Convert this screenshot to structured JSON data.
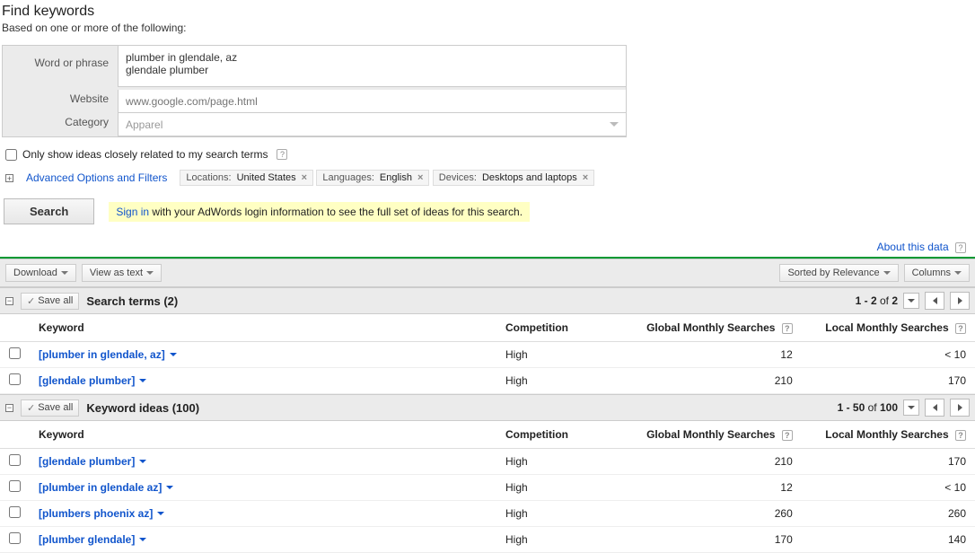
{
  "header": {
    "title": "Find keywords",
    "subtitle": "Based on one or more of the following:"
  },
  "form": {
    "labels": {
      "word": "Word or phrase",
      "website": "Website",
      "category": "Category"
    },
    "word_value": "plumber in glendale, az\nglendale plumber",
    "website_placeholder": "www.google.com/page.html",
    "category_value": "Apparel"
  },
  "only_show": {
    "label": "Only show ideas closely related to my search terms"
  },
  "advanced": {
    "link": "Advanced Options and Filters",
    "chips": [
      {
        "label": "Locations:",
        "value": "United States"
      },
      {
        "label": "Languages:",
        "value": "English"
      },
      {
        "label": "Devices:",
        "value": "Desktops and laptops"
      }
    ]
  },
  "search_btn": "Search",
  "signin_hint": {
    "link": "Sign in",
    "rest": " with your AdWords login information to see the full set of ideas for this search."
  },
  "about_link": "About this data",
  "toolbar": {
    "download": "Download",
    "view_as_text": "View as text",
    "sort": "Sorted by Relevance",
    "columns": "Columns"
  },
  "section1": {
    "save_all": "Save all",
    "title": "Search terms (2)",
    "pager": {
      "range": "1 - 2",
      "of": "of",
      "total": "2"
    },
    "cols": {
      "kw": "Keyword",
      "comp": "Competition",
      "global": "Global Monthly Searches",
      "local": "Local Monthly Searches"
    },
    "rows": [
      {
        "kw": "[plumber in glendale, az]",
        "comp": "High",
        "global": "12",
        "local": "< 10"
      },
      {
        "kw": "[glendale plumber]",
        "comp": "High",
        "global": "210",
        "local": "170"
      }
    ]
  },
  "section2": {
    "save_all": "Save all",
    "title": "Keyword ideas (100)",
    "pager": {
      "range": "1 - 50",
      "of": "of",
      "total": "100"
    },
    "cols": {
      "kw": "Keyword",
      "comp": "Competition",
      "global": "Global Monthly Searches",
      "local": "Local Monthly Searches"
    },
    "rows": [
      {
        "kw": "[glendale plumber]",
        "comp": "High",
        "global": "210",
        "local": "170"
      },
      {
        "kw": "[plumber in glendale az]",
        "comp": "High",
        "global": "12",
        "local": "< 10"
      },
      {
        "kw": "[plumbers phoenix az]",
        "comp": "High",
        "global": "260",
        "local": "260"
      },
      {
        "kw": "[plumber glendale]",
        "comp": "High",
        "global": "170",
        "local": "140"
      }
    ]
  }
}
